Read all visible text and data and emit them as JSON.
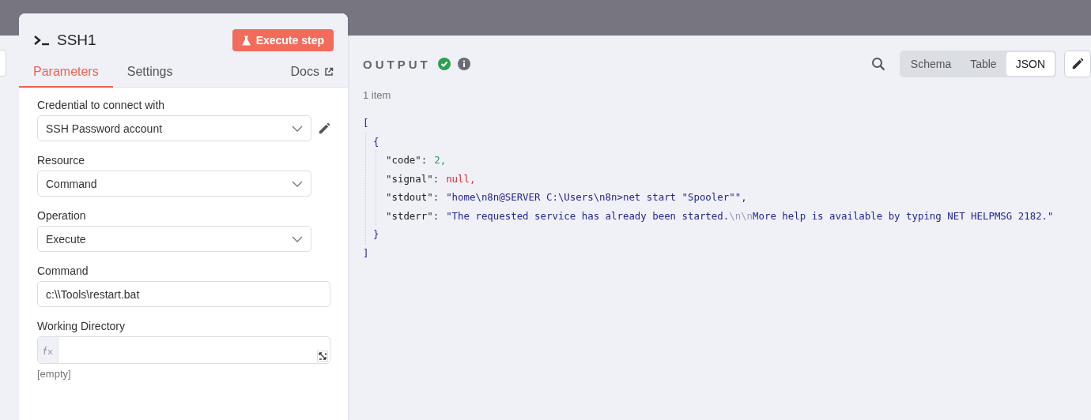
{
  "node": {
    "title": "SSH1",
    "execute_button": "Execute step"
  },
  "tabs": [
    {
      "label": "Parameters",
      "selected": true
    },
    {
      "label": "Settings",
      "selected": false
    }
  ],
  "docs_link": "Docs",
  "fields": [
    {
      "kind": "select",
      "label": "Credential to connect with",
      "value": "SSH Password account",
      "editable": true
    },
    {
      "kind": "select",
      "label": "Resource",
      "value": "Command",
      "editable": false
    },
    {
      "kind": "select",
      "label": "Operation",
      "value": "Execute",
      "editable": false
    },
    {
      "kind": "text",
      "label": "Command",
      "value": "c:\\\\Tools\\restart.bat"
    },
    {
      "kind": "expression",
      "label": "Working Directory",
      "hint": "[empty]"
    }
  ],
  "output": {
    "title": "OUTPUT",
    "success": true,
    "item_count": "1 item",
    "views": [
      {
        "label": "Schema",
        "selected": false
      },
      {
        "label": "Table",
        "selected": false
      },
      {
        "label": "JSON",
        "selected": true
      }
    ],
    "open_bracket": "[",
    "open_brace": "{",
    "entries": [
      {
        "key": "\"code\":",
        "kind": "number",
        "parts": [
          {
            "text": "2",
            "kind": "text"
          }
        ],
        "comma": ","
      },
      {
        "key": "\"signal\":",
        "kind": "null",
        "parts": [
          {
            "text": "null",
            "kind": "text"
          }
        ],
        "comma": ","
      },
      {
        "key": "\"stdout\":",
        "kind": "string",
        "parts": [
          {
            "text": "\"home\\n8n@SERVER C:\\Users\\n8n>net start \"Spooler\"\"",
            "kind": "text"
          }
        ],
        "comma": ","
      },
      {
        "key": "\"stderr\":",
        "kind": "string",
        "parts": [
          {
            "text": "\"The requested service has already been started.",
            "kind": "text"
          },
          {
            "text": "\\n\\n",
            "kind": "escape"
          },
          {
            "text": "More help is available by typing NET HELPMSG 2182.\"",
            "kind": "text"
          }
        ]
      }
    ],
    "close_brace": "}",
    "close_bracket": "]"
  }
}
